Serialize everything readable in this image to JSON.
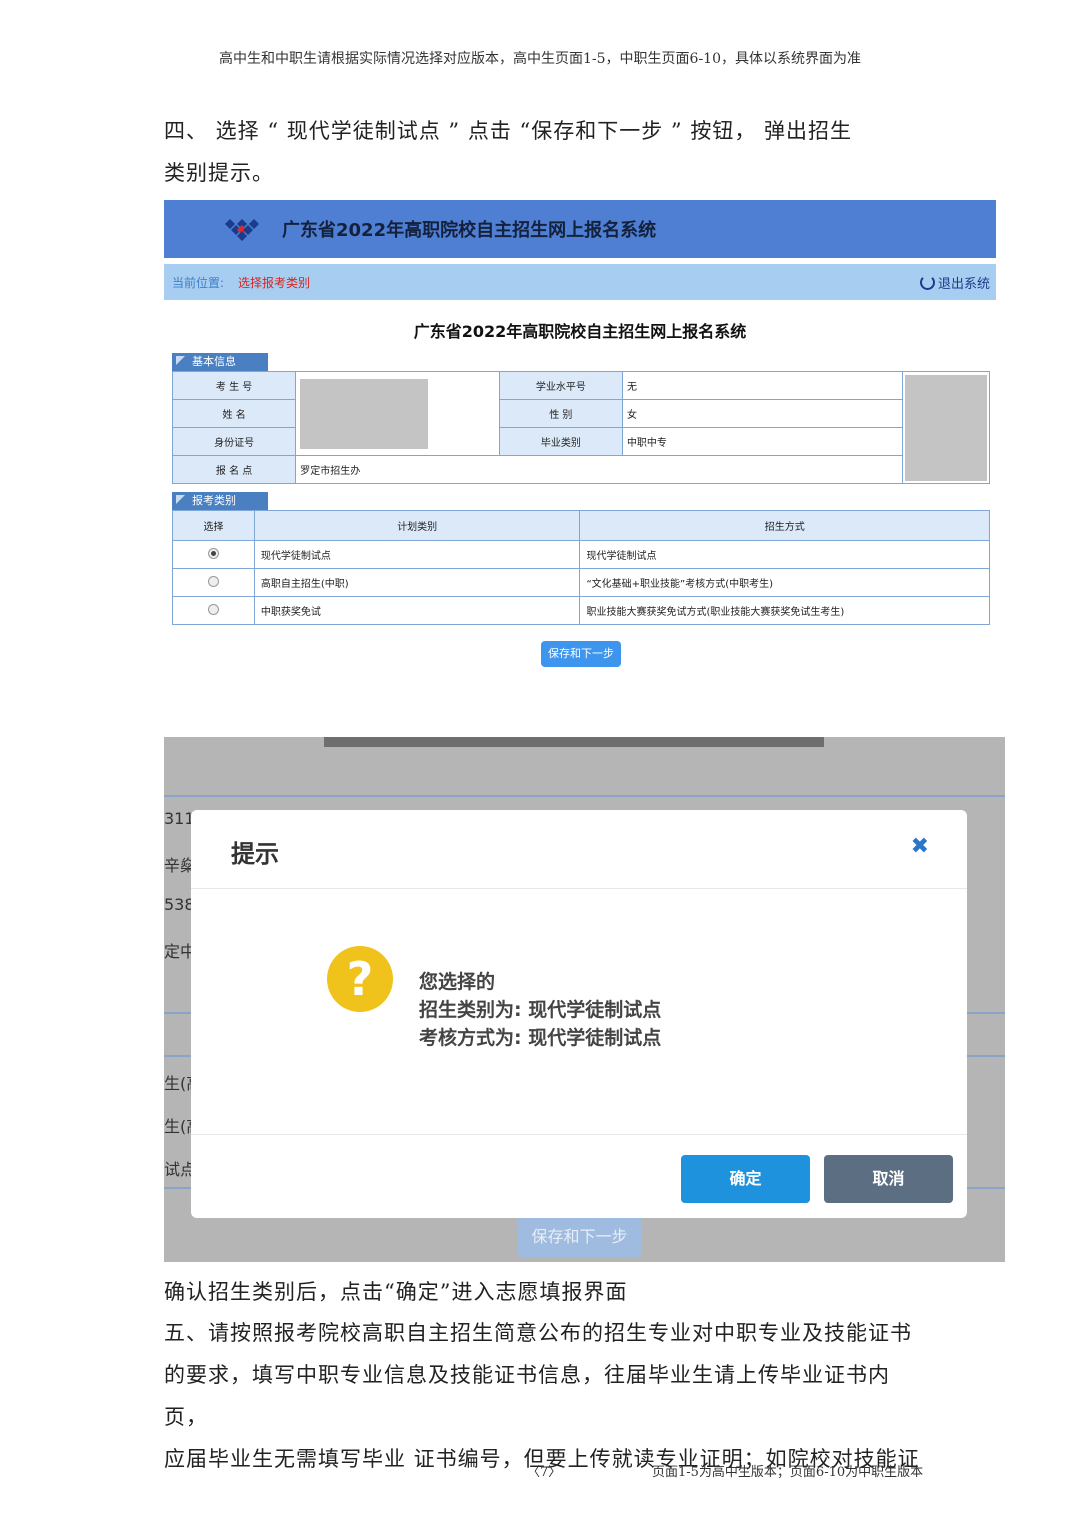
{
  "header_note": "高中生和中职生请根据实际情况选择对应版本，高中生页面1-5，中职生页面6-10，具体以系统界面为准",
  "step4": {
    "line1": "四、  选择  “ 现代学徒制试点 ”  点击  “保存和下一步 ”  按钮，  弹出招生",
    "line2": "类别提示。"
  },
  "screen1": {
    "banner_title": "广东省2022年高职院校自主招生网上报名系统",
    "breadcrumb_label": "当前位置:",
    "breadcrumb_value": "选择报考类别",
    "logout": "退出系统",
    "system_title": "广东省2022年高职院校自主招生网上报名系统",
    "basic_info_tab": "基本信息",
    "rows": [
      {
        "label": "考 生 号",
        "label2": "学业水平号",
        "value2": "无"
      },
      {
        "label": "姓    名",
        "label2": "性    别",
        "value2": "女"
      },
      {
        "label": "身份证号",
        "label2": "毕业类别",
        "value2": "中职中专"
      },
      {
        "label": "报 名 点",
        "value": "罗定市招生办"
      }
    ],
    "category_tab": "报考类别",
    "category_headers": [
      "选择",
      "计划类别",
      "招生方式"
    ],
    "categories": [
      {
        "plan": "现代学徒制试点",
        "method": "现代学徒制试点",
        "selected": true
      },
      {
        "plan": "高职自主招生(中职)",
        "method": "“文化基础+职业技能”考核方式(中职考生)",
        "selected": false
      },
      {
        "plan": "中职获奖免试",
        "method": "职业技能大赛获奖免试方式(职业技能大赛获奖免试生考生)",
        "selected": false
      }
    ],
    "save_button": "保存和下一步"
  },
  "screen2": {
    "bg_fragments": [
      "311",
      "辛燊",
      "538",
      "定中",
      "生(高",
      "生(高",
      "试点"
    ],
    "bg_button": "保存和下一步",
    "dialog": {
      "title": "提示",
      "close_symbol": "✖",
      "icon_symbol": "?",
      "line1": "您选择的",
      "line2": "招生类别为:  现代学徒制试点",
      "line3": "考核方式为:  现代学徒制试点",
      "ok": "确定",
      "cancel": "取消"
    }
  },
  "after_text": "确认招生类别后，点击“确定”进入志愿填报界面",
  "step5": [
    "五、请按照报考院校高职自主招生简意公布的招生专业对中职专业及技能证书",
    "的要求，填写中职专业信息及技能证书信息，往届毕业生请上传毕业证书内页，",
    "应届毕业生无需填写毕业  证书编号，但要上传就读专业证明；如院校对技能证"
  ],
  "footer": {
    "page": "〈7〉",
    "note": "页面1-5为高中生版本；页面6-10为中职生版本"
  },
  "colors": {
    "banner": "#4f7fd3",
    "crumb_bar": "#a7cdf1",
    "accent_red": "#d9241c",
    "ok": "#1e92dd",
    "cancel": "#5c6f82",
    "warn_icon": "#f0c21c"
  }
}
